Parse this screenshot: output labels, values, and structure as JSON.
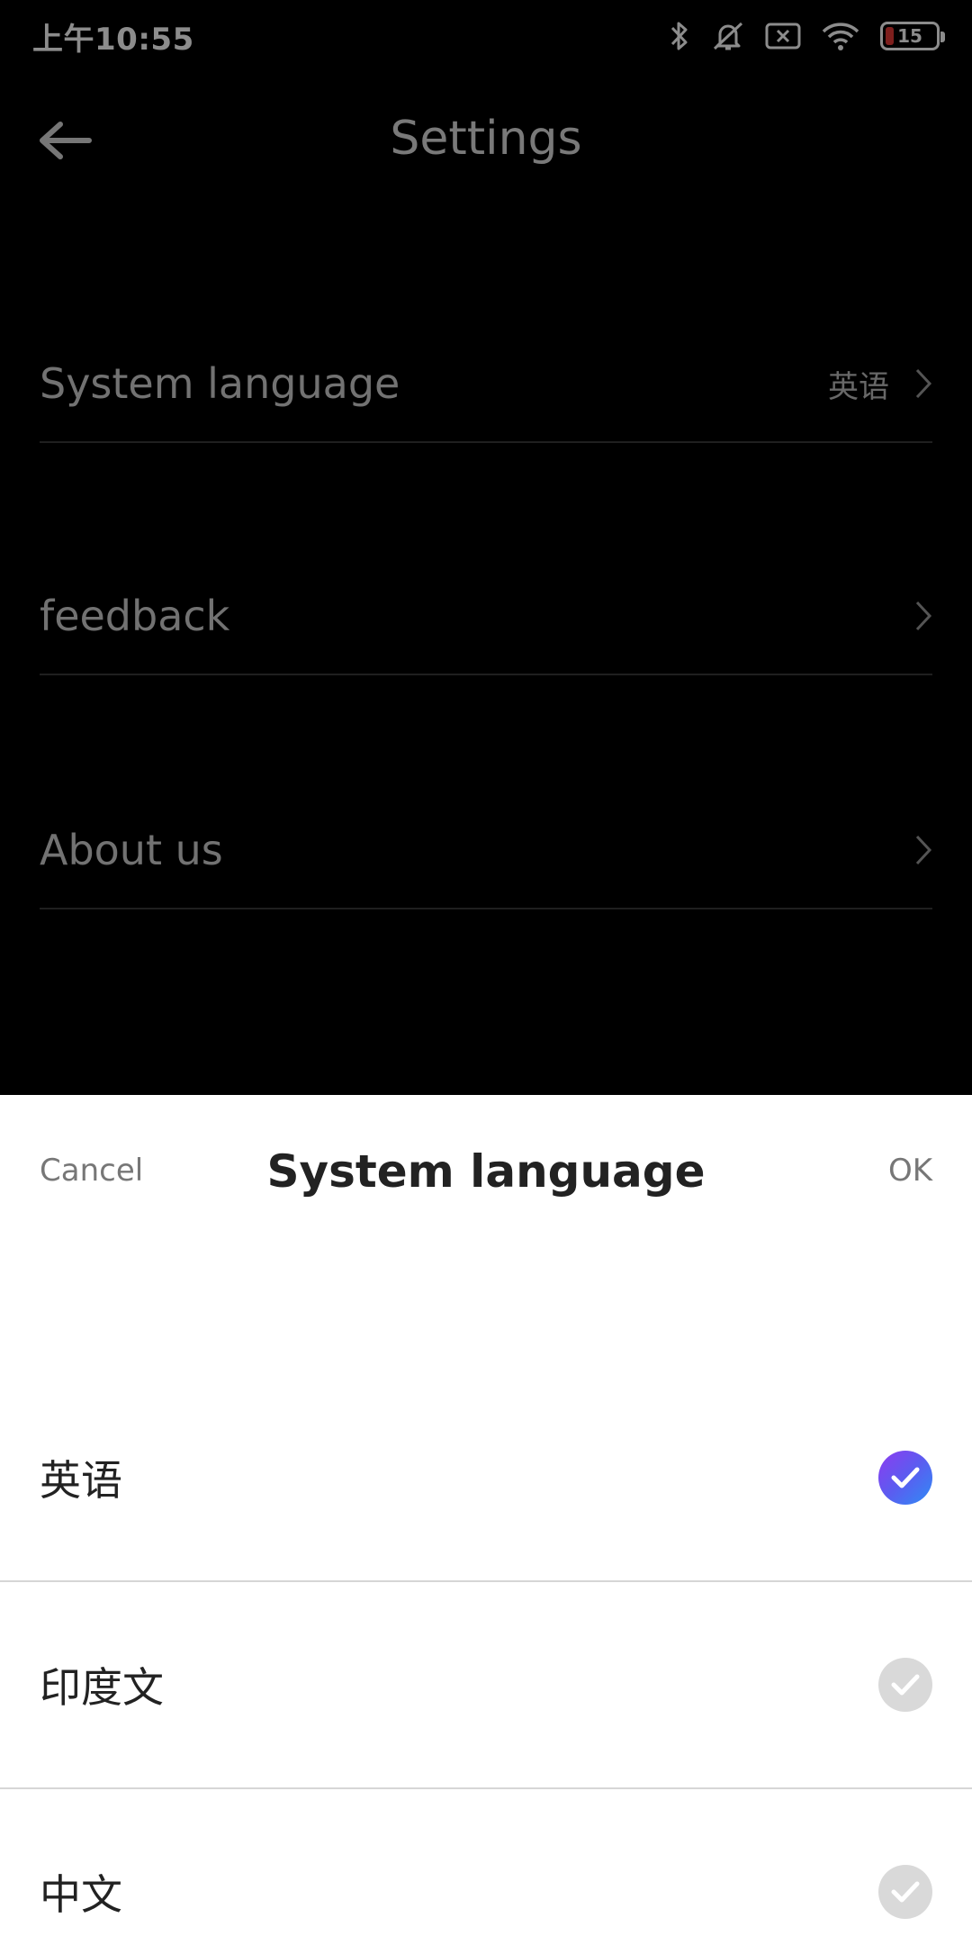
{
  "status_bar": {
    "time": "上午10:55",
    "battery_level": "15",
    "icons": [
      "bluetooth-icon",
      "mute-icon",
      "sim-error-icon",
      "wifi-icon",
      "battery-icon"
    ]
  },
  "header": {
    "title": "Settings",
    "back_icon": "arrow-left-icon"
  },
  "settings": {
    "items": [
      {
        "label": "System language",
        "value": "英语"
      },
      {
        "label": "feedback",
        "value": ""
      },
      {
        "label": "About us",
        "value": ""
      }
    ]
  },
  "language_sheet": {
    "title": "System language",
    "cancel_label": "Cancel",
    "ok_label": "OK",
    "options": [
      {
        "label": "英语",
        "selected": true
      },
      {
        "label": "印度文",
        "selected": false
      },
      {
        "label": "中文",
        "selected": false
      }
    ]
  },
  "colors": {
    "check_selected_gradient": [
      "#8e3bf0",
      "#5b5cf0",
      "#2f8cf5"
    ],
    "check_unselected": "#d9d9d9",
    "battery_low": "#e53935"
  }
}
